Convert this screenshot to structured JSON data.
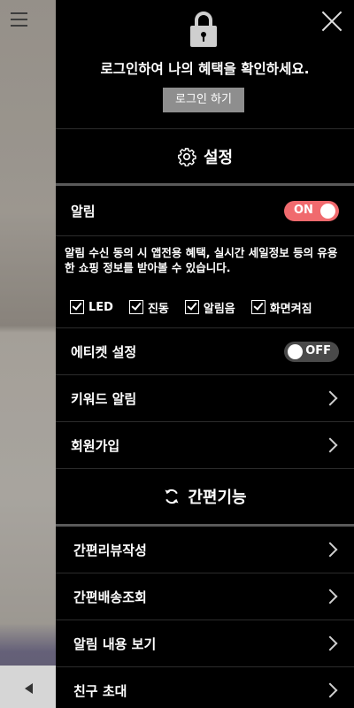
{
  "login": {
    "message": "로그인하여 나의 혜택을 확인하세요.",
    "button_label": "로그인 하기"
  },
  "settings": {
    "title": "설정",
    "notification": {
      "label": "알림",
      "toggle": "ON"
    },
    "description": "알림 수신 동의 시 앱전용 혜택, 실시간 세일정보 등의 유용한 쇼핑 정보를 받아볼 수 있습니다.",
    "checkboxes": [
      {
        "label": "LED",
        "checked": true
      },
      {
        "label": "진동",
        "checked": true
      },
      {
        "label": "알림음",
        "checked": true
      },
      {
        "label": "화면켜짐",
        "checked": true
      }
    ],
    "etiquette": {
      "label": "에티켓 설정",
      "toggle": "OFF"
    },
    "keyword_alert": "키워드 알림",
    "signup": "회원가입"
  },
  "quick": {
    "title": "간편기능",
    "items": [
      "간편리뷰작성",
      "간편배송조회",
      "알림 내용 보기",
      "친구 초대"
    ]
  },
  "icons": {
    "lock": "lock-icon",
    "gear": "gear-icon",
    "refresh": "refresh-icon",
    "close": "close-icon",
    "chevron": "chevron-right-icon",
    "hamburger": "hamburger-icon"
  },
  "colors": {
    "drawer_bg": "#000000",
    "toggle_on": "#f06a6e",
    "toggle_off": "#4a4a4a",
    "login_button": "#8e8e8e"
  }
}
